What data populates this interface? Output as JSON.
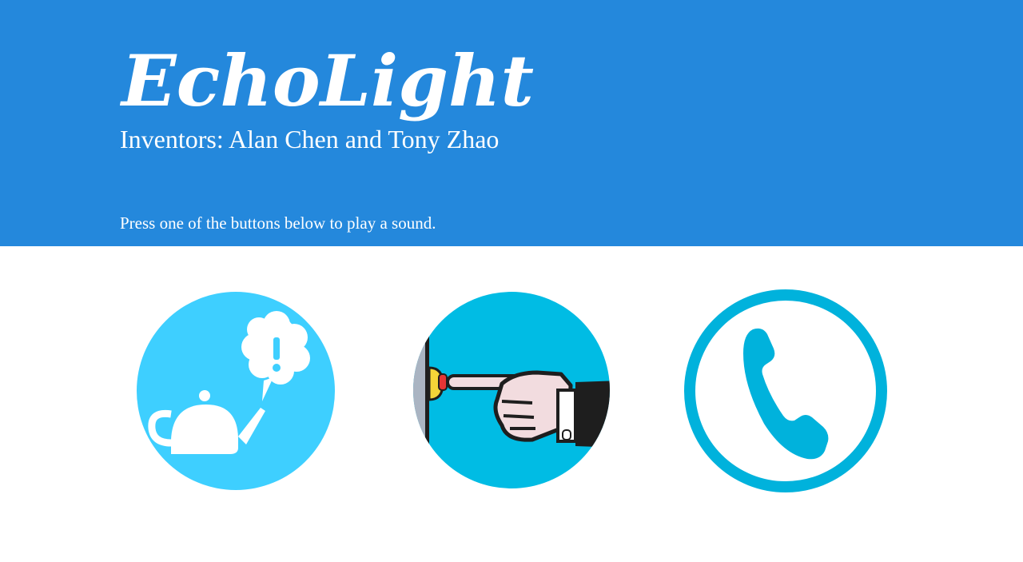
{
  "header": {
    "logo_text": "EchoLight",
    "subtitle": "Inventors: Alan Chen and Tony Zhao",
    "instructions": "Press one of the buttons below to play a sound.",
    "background_color": "#2488dc"
  },
  "sound_buttons": [
    {
      "icon": "kettle-alert-icon",
      "color": "#3ecfff"
    },
    {
      "icon": "doorbell-press-icon",
      "color": "#00bce4"
    },
    {
      "icon": "phone-icon",
      "color": "#00b2dc"
    }
  ]
}
